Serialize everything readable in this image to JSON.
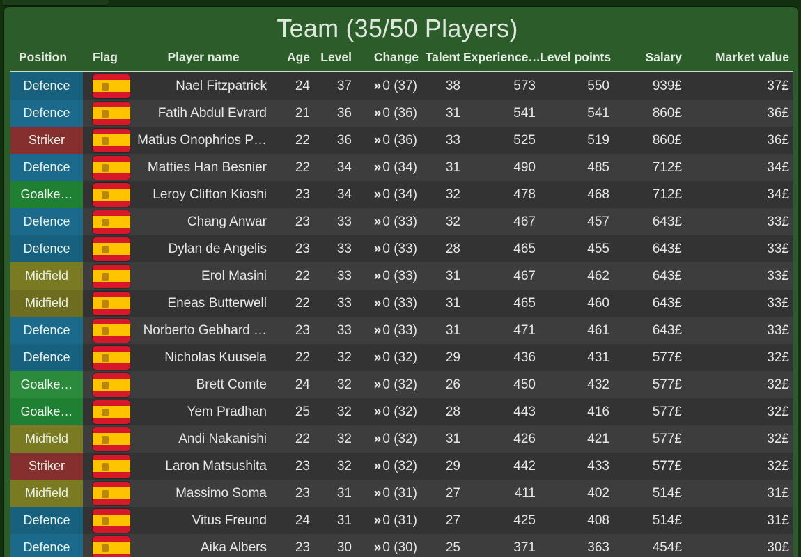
{
  "window": {
    "title": "Team (35/50 Players)",
    "accent_green": "#2b5c2a",
    "row_dark": "#333333",
    "row_light": "#3d3d3d"
  },
  "table": {
    "columns": [
      {
        "key": "position",
        "label": "Position"
      },
      {
        "key": "flag",
        "label": "Flag"
      },
      {
        "key": "name",
        "label": "Player name"
      },
      {
        "key": "age",
        "label": "Age"
      },
      {
        "key": "level",
        "label": "Level"
      },
      {
        "key": "change",
        "label": "Change"
      },
      {
        "key": "talent",
        "label": "Talent"
      },
      {
        "key": "experience",
        "label": "Experience…"
      },
      {
        "key": "levelpoints",
        "label": "Level points"
      },
      {
        "key": "salary",
        "label": "Salary"
      },
      {
        "key": "marketvalue",
        "label": "Market value"
      }
    ],
    "position_colors": {
      "Defence": "#1b6a8c",
      "Striker": "#8c3333",
      "Goalkeeper": "#2c8a3c",
      "Midfield": "#7a7a22"
    },
    "flag_name": "spain-flag-icon",
    "change_icon": "»",
    "rows": [
      {
        "position": "Defence",
        "position_label": "Defence",
        "name": "Nael Fitzpatrick",
        "age": "24",
        "level": "37",
        "change": "0 (37)",
        "talent": "38",
        "experience": "573",
        "levelpoints": "550",
        "salary": "939£",
        "marketvalue": "37£"
      },
      {
        "position": "Defence",
        "position_label": "Defence",
        "name": "Fatih Abdul Evrard",
        "age": "21",
        "level": "36",
        "change": "0 (36)",
        "talent": "31",
        "experience": "541",
        "levelpoints": "541",
        "salary": "860£",
        "marketvalue": "36£"
      },
      {
        "position": "Striker",
        "position_label": "Striker",
        "name": "Matius Onophrios P…",
        "age": "22",
        "level": "36",
        "change": "0 (36)",
        "talent": "33",
        "experience": "525",
        "levelpoints": "519",
        "salary": "860£",
        "marketvalue": "36£"
      },
      {
        "position": "Defence",
        "position_label": "Defence",
        "name": "Matties Han Besnier",
        "age": "22",
        "level": "34",
        "change": "0 (34)",
        "talent": "31",
        "experience": "490",
        "levelpoints": "485",
        "salary": "712£",
        "marketvalue": "34£"
      },
      {
        "position": "Goalkeeper",
        "position_label": "Goalke…",
        "name": "Leroy Clifton Kioshi",
        "age": "23",
        "level": "34",
        "change": "0 (34)",
        "talent": "32",
        "experience": "478",
        "levelpoints": "468",
        "salary": "712£",
        "marketvalue": "34£"
      },
      {
        "position": "Defence",
        "position_label": "Defence",
        "name": "Chang Anwar",
        "age": "23",
        "level": "33",
        "change": "0 (33)",
        "talent": "32",
        "experience": "467",
        "levelpoints": "457",
        "salary": "643£",
        "marketvalue": "33£"
      },
      {
        "position": "Defence",
        "position_label": "Defence",
        "name": "Dylan de Angelis",
        "age": "23",
        "level": "33",
        "change": "0 (33)",
        "talent": "28",
        "experience": "465",
        "levelpoints": "455",
        "salary": "643£",
        "marketvalue": "33£"
      },
      {
        "position": "Midfield",
        "position_label": "Midfield",
        "name": "Erol Masini",
        "age": "22",
        "level": "33",
        "change": "0 (33)",
        "talent": "31",
        "experience": "467",
        "levelpoints": "462",
        "salary": "643£",
        "marketvalue": "33£"
      },
      {
        "position": "Midfield",
        "position_label": "Midfield",
        "name": "Eneas Butterwell",
        "age": "22",
        "level": "33",
        "change": "0 (33)",
        "talent": "31",
        "experience": "465",
        "levelpoints": "460",
        "salary": "643£",
        "marketvalue": "33£"
      },
      {
        "position": "Defence",
        "position_label": "Defence",
        "name": "Norberto Gebhard …",
        "age": "23",
        "level": "33",
        "change": "0 (33)",
        "talent": "31",
        "experience": "471",
        "levelpoints": "461",
        "salary": "643£",
        "marketvalue": "33£"
      },
      {
        "position": "Defence",
        "position_label": "Defence",
        "name": "Nicholas Kuusela",
        "age": "22",
        "level": "32",
        "change": "0 (32)",
        "talent": "29",
        "experience": "436",
        "levelpoints": "431",
        "salary": "577£",
        "marketvalue": "32£"
      },
      {
        "position": "Goalkeeper",
        "position_label": "Goalke…",
        "name": "Brett Comte",
        "age": "24",
        "level": "32",
        "change": "0 (32)",
        "talent": "26",
        "experience": "450",
        "levelpoints": "432",
        "salary": "577£",
        "marketvalue": "32£"
      },
      {
        "position": "Goalkeeper",
        "position_label": "Goalke…",
        "name": "Yem Pradhan",
        "age": "25",
        "level": "32",
        "change": "0 (32)",
        "talent": "28",
        "experience": "443",
        "levelpoints": "416",
        "salary": "577£",
        "marketvalue": "32£"
      },
      {
        "position": "Midfield",
        "position_label": "Midfield",
        "name": "Andi Nakanishi",
        "age": "22",
        "level": "32",
        "change": "0 (32)",
        "talent": "31",
        "experience": "426",
        "levelpoints": "421",
        "salary": "577£",
        "marketvalue": "32£"
      },
      {
        "position": "Striker",
        "position_label": "Striker",
        "name": "Laron Matsushita",
        "age": "23",
        "level": "32",
        "change": "0 (32)",
        "talent": "29",
        "experience": "442",
        "levelpoints": "433",
        "salary": "577£",
        "marketvalue": "32£"
      },
      {
        "position": "Midfield",
        "position_label": "Midfield",
        "name": "Massimo Soma",
        "age": "23",
        "level": "31",
        "change": "0 (31)",
        "talent": "27",
        "experience": "411",
        "levelpoints": "402",
        "salary": "514£",
        "marketvalue": "31£"
      },
      {
        "position": "Defence",
        "position_label": "Defence",
        "name": "Vitus Freund",
        "age": "24",
        "level": "31",
        "change": "0 (31)",
        "talent": "27",
        "experience": "425",
        "levelpoints": "408",
        "salary": "514£",
        "marketvalue": "31£"
      },
      {
        "position": "Defence",
        "position_label": "Defence",
        "name": "Aika Albers",
        "age": "23",
        "level": "30",
        "change": "0 (30)",
        "talent": "25",
        "experience": "371",
        "levelpoints": "363",
        "salary": "454£",
        "marketvalue": "30£"
      }
    ]
  }
}
